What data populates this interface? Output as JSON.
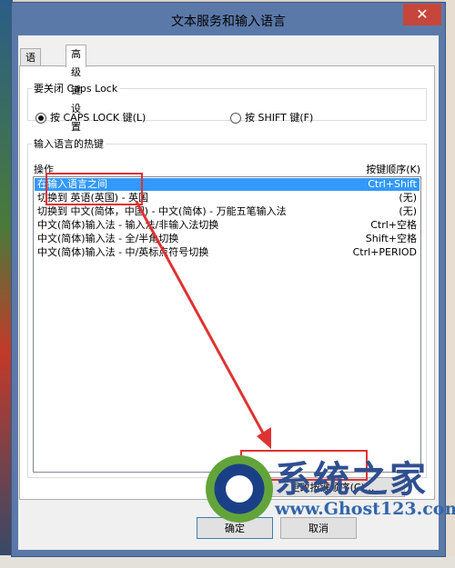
{
  "window": {
    "title": "文本服务和输入语言",
    "close_label": "✕"
  },
  "tabs": [
    {
      "label": "语言栏"
    },
    {
      "label": "高级键设置"
    }
  ],
  "capslock": {
    "legend": "要关闭 Caps Lock",
    "option1": "按 CAPS LOCK 键(L)",
    "option2": "按 SHIFT 键(F)",
    "selected": "option1"
  },
  "hotkeys": {
    "legend": "输入语言的热键",
    "col_action": "操作",
    "col_key": "按键顺序(K)",
    "rows": [
      {
        "action": "在输入语言之间",
        "key": "Ctrl+Shift",
        "selected": true
      },
      {
        "action": "切换到 英语(英国) - 英国",
        "key": "(无)"
      },
      {
        "action": "切换到 中文(简体，中国) - 中文(简体) - 万能五笔输入法",
        "key": "(无)"
      },
      {
        "action": "中文(简体)输入法 - 输入法/非输入法切换",
        "key": "Ctrl+空格"
      },
      {
        "action": "中文(简体)输入法 - 全/半角切换",
        "key": "Shift+空格"
      },
      {
        "action": "中文(简体)输入法 - 中/英标点符号切换",
        "key": "Ctrl+PERIOD"
      }
    ],
    "change_button": "更改按键顺序(C)..."
  },
  "footer": {
    "ok": "确定",
    "cancel": "取消"
  },
  "watermark": {
    "title": "系统之家",
    "url": "www.Ghost123.com"
  },
  "colors": {
    "selection": "#3399ff",
    "annotation": "#e03232",
    "frame": "#5a79a9"
  }
}
